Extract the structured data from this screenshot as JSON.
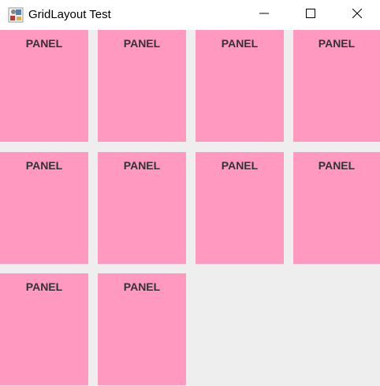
{
  "window": {
    "title": "GridLayout Test",
    "icon": "java-app-icon",
    "controls": [
      "minimize-icon",
      "maximize-icon",
      "close-icon"
    ]
  },
  "colors": {
    "panel_bg": "#ff99bf",
    "panel_text": "#333333",
    "content_bg": "#eeeeee",
    "titlebar_bg": "#ffffff"
  },
  "grid": {
    "rows": 3,
    "columns": 4,
    "panels": [
      {
        "label": "PANEL"
      },
      {
        "label": "PANEL"
      },
      {
        "label": "PANEL"
      },
      {
        "label": "PANEL"
      },
      {
        "label": "PANEL"
      },
      {
        "label": "PANEL"
      },
      {
        "label": "PANEL"
      },
      {
        "label": "PANEL"
      },
      {
        "label": "PANEL"
      },
      {
        "label": "PANEL"
      }
    ]
  }
}
